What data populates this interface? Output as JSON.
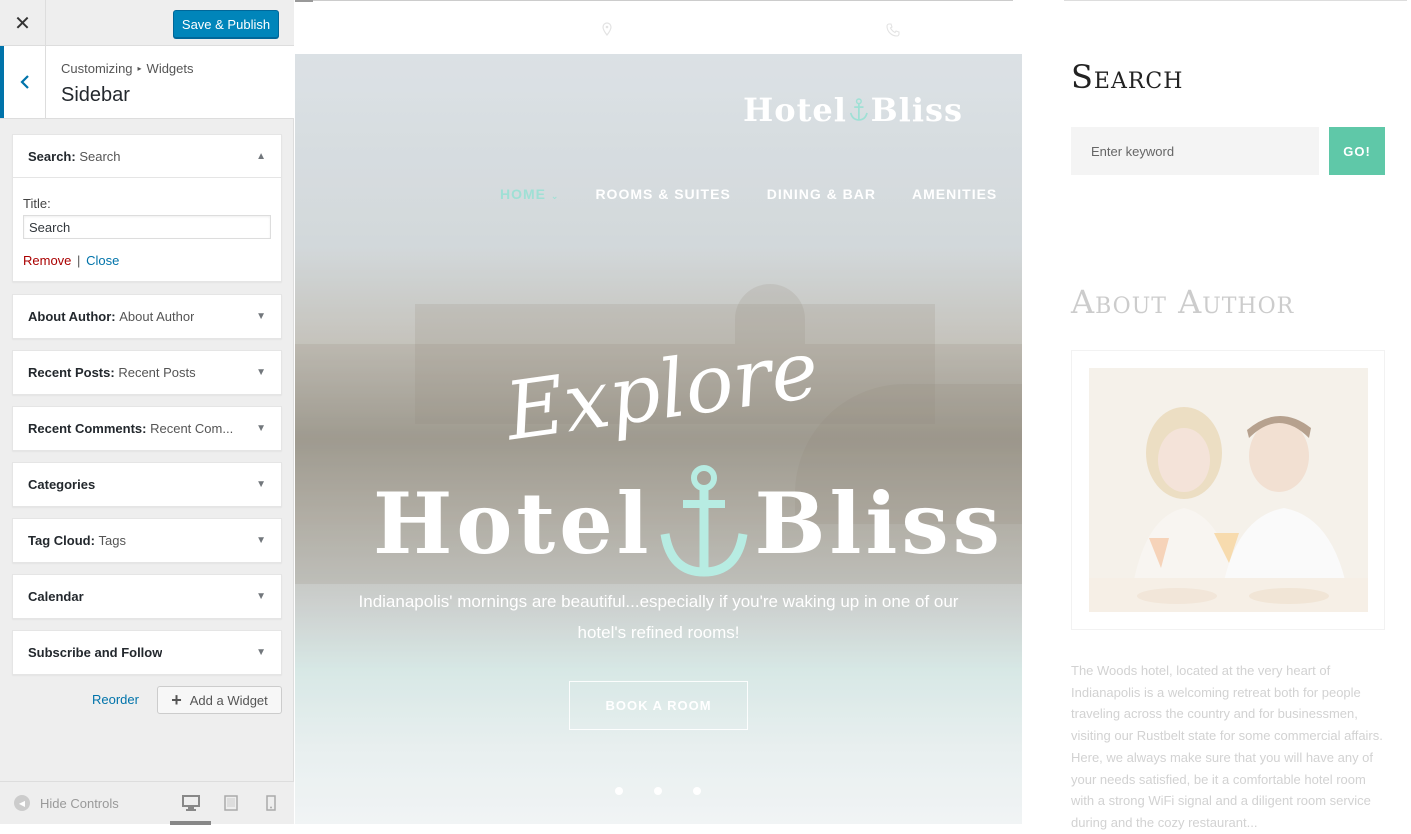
{
  "customizer": {
    "close_icon": "close-icon",
    "save_label": "Save & Publish",
    "breadcrumb": {
      "root": "Customizing",
      "current": "Widgets"
    },
    "section_title": "Sidebar",
    "widgets": [
      {
        "name": "Search",
        "sub": "Search",
        "expanded": true
      },
      {
        "name": "About Author",
        "sub": "About Author"
      },
      {
        "name": "Recent Posts",
        "sub": "Recent Posts"
      },
      {
        "name": "Recent Comments",
        "sub": "Recent Com..."
      },
      {
        "name": "Categories",
        "sub": ""
      },
      {
        "name": "Tag Cloud",
        "sub": "Tags"
      },
      {
        "name": "Calendar",
        "sub": ""
      },
      {
        "name": "Subscribe and Follow",
        "sub": ""
      }
    ],
    "search_widget": {
      "title_label": "Title:",
      "title_value": "Search",
      "remove_label": "Remove",
      "separator": "|",
      "close_label": "Close"
    },
    "reorder_label": "Reorder",
    "add_widget_label": "Add a Widget",
    "hide_controls_label": "Hide Controls",
    "devices": [
      "desktop",
      "tablet",
      "mobile"
    ],
    "accent_color": "#0085ba"
  },
  "preview": {
    "logo": {
      "word1": "Hotel",
      "word2": "Bliss"
    },
    "nav": {
      "home": "HOME",
      "rooms": "ROOMS & SUITES",
      "dining": "DINING & BAR",
      "amenities": "AMENITIES"
    },
    "hero": {
      "script": "Explore",
      "title_word1": "Hotel",
      "title_word2": "Bliss",
      "tagline": "Indianapolis' mornings are beautiful...especially if you're waking up in one of our hotel's refined rooms!",
      "button": "BOOK A ROOM",
      "slides": 3,
      "active_slide": 2
    },
    "sidebar": {
      "search_heading": "Search",
      "search_placeholder": "Enter keyword",
      "search_button": "GO!",
      "about_heading": "About Author",
      "about_text": "The Woods hotel, located at the very heart of Indianapolis is a welcoming retreat both for people traveling across the country and for businessmen, visiting our Rustbelt state for some commercial affairs. Here, we always make sure that you will have any of your needs satisfied, be it a comfortable hotel room with a strong WiFi signal and a diligent room service during and the cozy restaurant..."
    },
    "accent_color": "#5fc8a8"
  }
}
